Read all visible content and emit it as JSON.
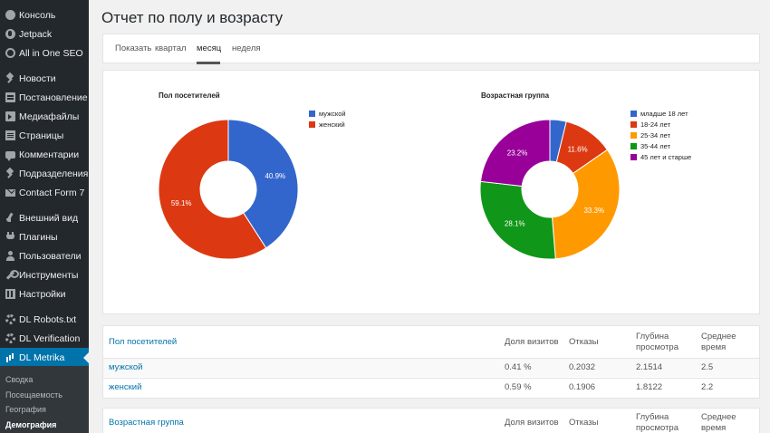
{
  "sidebar": {
    "items": [
      {
        "label": "Консоль",
        "icon": "dashboard-icon"
      },
      {
        "label": "Jetpack",
        "icon": "jetpack-icon"
      },
      {
        "label": "All in One SEO",
        "icon": "seo-icon"
      },
      {
        "label": "Новости",
        "icon": "pin-icon"
      },
      {
        "label": "Постановление",
        "icon": "documents-icon"
      },
      {
        "label": "Медиафайлы",
        "icon": "media-icon"
      },
      {
        "label": "Страницы",
        "icon": "page-icon"
      },
      {
        "label": "Комментарии",
        "icon": "comment-icon"
      },
      {
        "label": "Подразделения",
        "icon": "pin-icon"
      },
      {
        "label": "Contact Form 7",
        "icon": "mail-icon"
      },
      {
        "label": "Внешний вид",
        "icon": "brush-icon"
      },
      {
        "label": "Плагины",
        "icon": "plugin-icon"
      },
      {
        "label": "Пользователи",
        "icon": "user-icon"
      },
      {
        "label": "Инструменты",
        "icon": "wrench-icon"
      },
      {
        "label": "Настройки",
        "icon": "settings-icon"
      },
      {
        "label": "DL Robots.txt",
        "icon": "gear-icon"
      },
      {
        "label": "DL Verification",
        "icon": "gear-icon"
      },
      {
        "label": "DL Metrika",
        "icon": "bar-chart-icon"
      }
    ],
    "submenu": [
      "Сводка",
      "Посещаемость",
      "География",
      "Демография"
    ]
  },
  "page": {
    "title": "Отчет по полу и возрасту"
  },
  "tabs": {
    "label": "Показать",
    "items": [
      "квартал",
      "месяц",
      "неделя"
    ],
    "active": "месяц"
  },
  "chart_data": [
    {
      "type": "pie",
      "title": "Пол посетителей",
      "categories": [
        "мужской",
        "женский"
      ],
      "values": [
        40.9,
        59.1
      ],
      "labels": [
        "40.9%",
        "59.1%"
      ],
      "colors": [
        "#3366cc",
        "#dc3912"
      ],
      "legend": "right"
    },
    {
      "type": "pie",
      "title": "Возрастная группа",
      "categories": [
        "младше 18 лет",
        "18-24 лет",
        "25-34 лет",
        "35-44 лет",
        "45 лет и старше"
      ],
      "values": [
        3.8,
        11.6,
        33.3,
        28.1,
        23.2
      ],
      "labels": [
        "",
        "11.6%",
        "33.3%",
        "28.1%",
        "23.2%"
      ],
      "colors": [
        "#3366cc",
        "#dc3912",
        "#ff9900",
        "#109618",
        "#990099"
      ],
      "legend": "right"
    }
  ],
  "table_gender": {
    "headers": [
      "Пол посетителей",
      "Доля визитов",
      "Отказы",
      "Глубина просмотра",
      "Среднее время"
    ],
    "rows": [
      [
        "мужской",
        "0.41 %",
        "0.2032",
        "2.1514",
        "2.5"
      ],
      [
        "женский",
        "0.59 %",
        "0.1906",
        "1.8122",
        "2.2"
      ]
    ]
  },
  "table_age": {
    "headers": [
      "Возрастная группа",
      "Доля визитов",
      "Отказы",
      "Глубина просмотра",
      "Среднее время"
    ]
  }
}
